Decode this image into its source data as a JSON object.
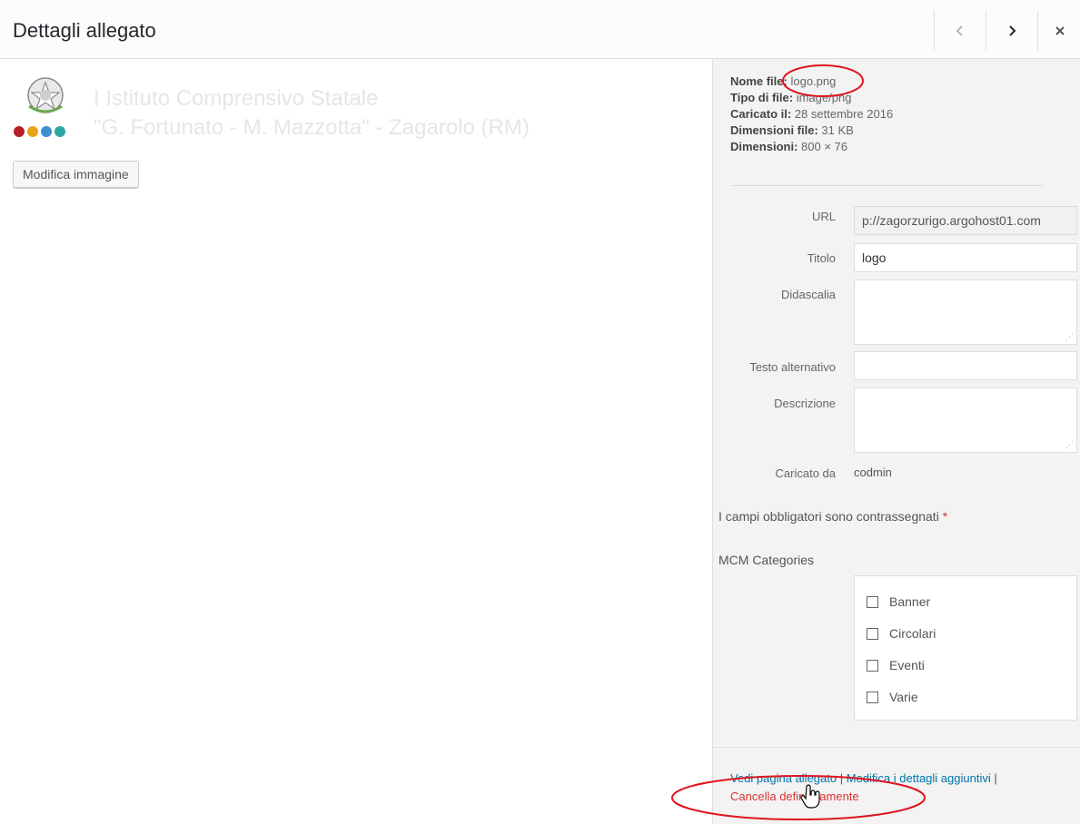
{
  "header": {
    "title": "Dettagli allegato"
  },
  "left": {
    "edit_image_label": "Modifica immagine",
    "logo_line1": "I Istituto Comprensivo Statale",
    "logo_line2": "\"G. Fortunato - M. Mazzotta\"  -  Zagarolo (RM)"
  },
  "meta": {
    "file_name_label": "Nome file:",
    "file_name": "logo.png",
    "file_type_label": "Tipo di file:",
    "file_type": "image/png",
    "uploaded_label": "Caricato il:",
    "uploaded": "28 settembre 2016",
    "file_size_label": "Dimensioni file:",
    "file_size": "31 KB",
    "dimensions_label": "Dimensioni:",
    "dimensions": "800 × 76"
  },
  "form": {
    "url_label": "URL",
    "url_value": "p://zagorzurigo.argohost01.com",
    "title_label": "Titolo",
    "title_value": "logo",
    "caption_label": "Didascalia",
    "alt_label": "Testo alternativo",
    "description_label": "Descrizione",
    "uploaded_by_label": "Caricato da",
    "uploaded_by": "codmin",
    "required_note": "I campi obbligatori sono contrassegnati",
    "required_mark": "*"
  },
  "categories": {
    "label": "MCM Categories",
    "items": [
      "Banner",
      "Circolari",
      "Eventi",
      "Varie"
    ]
  },
  "actions": {
    "view_page": "Vedi pagina allegato",
    "edit_details": "Modifica i dettagli aggiuntivi",
    "separator": "|",
    "delete": "Cancella definitivamente"
  },
  "colors": {
    "link": "#0073aa",
    "danger": "#dc3232",
    "annotation": "#e0141e"
  }
}
